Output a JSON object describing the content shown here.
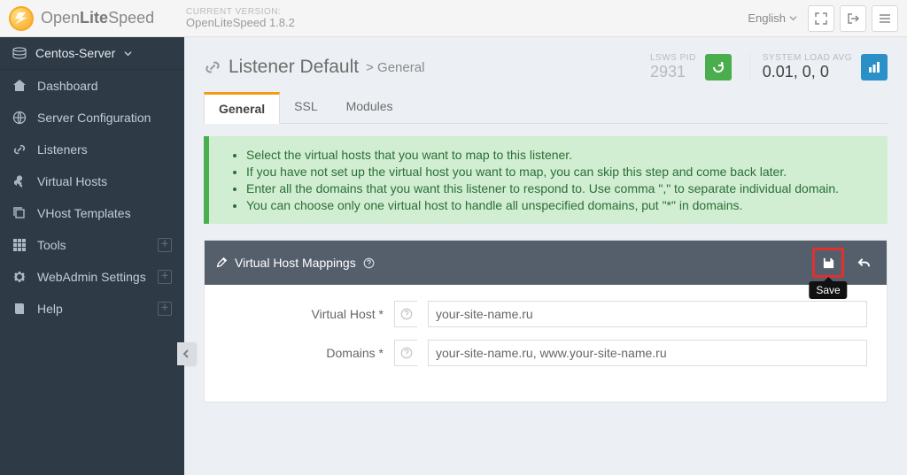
{
  "brand": {
    "name_light": "Open",
    "name_bold": "Lite",
    "name_tail": "Speed"
  },
  "version": {
    "label": "CURRENT VERSION:",
    "value": "OpenLiteSpeed 1.8.2"
  },
  "topbar": {
    "language": "English",
    "fullscreen_icon": "expand-icon",
    "logout_icon": "logout-icon",
    "menu_icon": "menu-icon"
  },
  "server_selector": "Centos-Server",
  "sidebar": {
    "items": [
      {
        "label": "Dashboard",
        "icon": "home-icon",
        "expand": false
      },
      {
        "label": "Server Configuration",
        "icon": "globe-icon",
        "expand": false
      },
      {
        "label": "Listeners",
        "icon": "link-icon",
        "expand": false
      },
      {
        "label": "Virtual Hosts",
        "icon": "cubes-icon",
        "expand": false
      },
      {
        "label": "VHost Templates",
        "icon": "clone-icon",
        "expand": false
      },
      {
        "label": "Tools",
        "icon": "grid-icon",
        "expand": true
      },
      {
        "label": "WebAdmin Settings",
        "icon": "gear-icon",
        "expand": true
      },
      {
        "label": "Help",
        "icon": "book-icon",
        "expand": true
      }
    ]
  },
  "page": {
    "title": "Listener Default",
    "crumb": "General",
    "pid_label": "LSWS PID",
    "pid_value": "2931",
    "load_label": "SYSTEM LOAD AVG",
    "load_value": "0.01, 0, 0"
  },
  "tabs": [
    {
      "label": "General",
      "active": true
    },
    {
      "label": "SSL",
      "active": false
    },
    {
      "label": "Modules",
      "active": false
    }
  ],
  "tips": [
    "Select the virtual hosts that you want to map to this listener.",
    "If you have not set up the virtual host you want to map, you can skip this step and come back later.",
    "Enter all the domains that you want this listener to respond to. Use comma \",\" to separate individual domain.",
    "You can choose only one virtual host to handle all unspecified domains, put \"*\" in domains."
  ],
  "panel": {
    "title": "Virtual Host Mappings",
    "save_tooltip": "Save",
    "fields": {
      "vhost_label": "Virtual Host *",
      "vhost_value": "your-site-name.ru",
      "domains_label": "Domains *",
      "domains_value": "your-site-name.ru, www.your-site-name.ru"
    }
  }
}
